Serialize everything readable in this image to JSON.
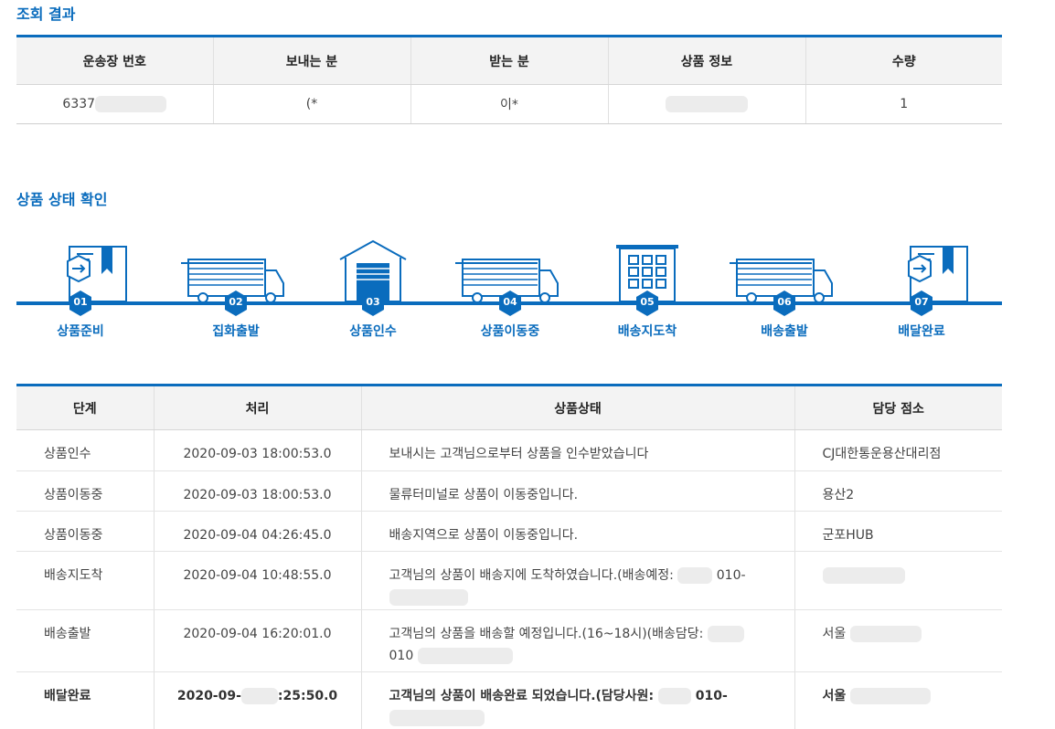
{
  "sections": {
    "result_title": "조회 결과",
    "status_title": "상품 상태 확인"
  },
  "result_table": {
    "headers": [
      "운송장 번호",
      "보내는 분",
      "받는 분",
      "상품 정보",
      "수량"
    ],
    "row": {
      "tracking": "6337",
      "sender": "(*",
      "receiver": "이*",
      "product": "",
      "quantity": "1"
    }
  },
  "steps": [
    {
      "num": "01",
      "label": "상품준비",
      "icon": "package-icon"
    },
    {
      "num": "02",
      "label": "집화출발",
      "icon": "truck-icon"
    },
    {
      "num": "03",
      "label": "상품인수",
      "icon": "warehouse-icon"
    },
    {
      "num": "04",
      "label": "상품이동중",
      "icon": "truck-icon"
    },
    {
      "num": "05",
      "label": "배송지도착",
      "icon": "building-icon"
    },
    {
      "num": "06",
      "label": "배송출발",
      "icon": "truck-icon"
    },
    {
      "num": "07",
      "label": "배달완료",
      "icon": "package-icon"
    }
  ],
  "status_table": {
    "headers": [
      "단계",
      "처리",
      "상품상태",
      "담당 점소"
    ],
    "rows": [
      {
        "step": "상품인수",
        "time": "2020-09-03 18:00:53.0",
        "desc": "보내시는 고객님으로부터 상품을 인수받았습니다",
        "desc2": "",
        "office": "CJ대한통운용산대리점"
      },
      {
        "step": "상품이동중",
        "time": "2020-09-03 18:00:53.0",
        "desc": "물류터미널로 상품이 이동중입니다.",
        "desc2": "",
        "office": "용산2"
      },
      {
        "step": "상품이동중",
        "time": "2020-09-04 04:26:45.0",
        "desc": "배송지역으로 상품이 이동중입니다.",
        "desc2": "",
        "office": "군포HUB"
      },
      {
        "step": "배송지도착",
        "time": "2020-09-04 10:48:55.0",
        "desc": "고객님의 상품이 배송지에 도착하였습니다.(배송예정:",
        "desc_tail": "010-",
        "desc2": "",
        "office": ""
      },
      {
        "step": "배송출발",
        "time": "2020-09-04 16:20:01.0",
        "desc": "고객님의 상품을 배송할 예정입니다.(16~18시)(배송담당:",
        "desc_tail": "",
        "desc2": "010",
        "office": "서울"
      },
      {
        "step": "배달완료",
        "time_a": "2020-09-",
        "time_b": ":25:50.0",
        "desc": "고객님의 상품이 배송완료 되었습니다.(담당사원:",
        "desc_tail": "010-",
        "desc2": "",
        "office": "서울"
      }
    ]
  },
  "colors": {
    "accent": "#0a6cbd",
    "header_bg": "#f3f3f3",
    "redacted": "#ececec"
  }
}
